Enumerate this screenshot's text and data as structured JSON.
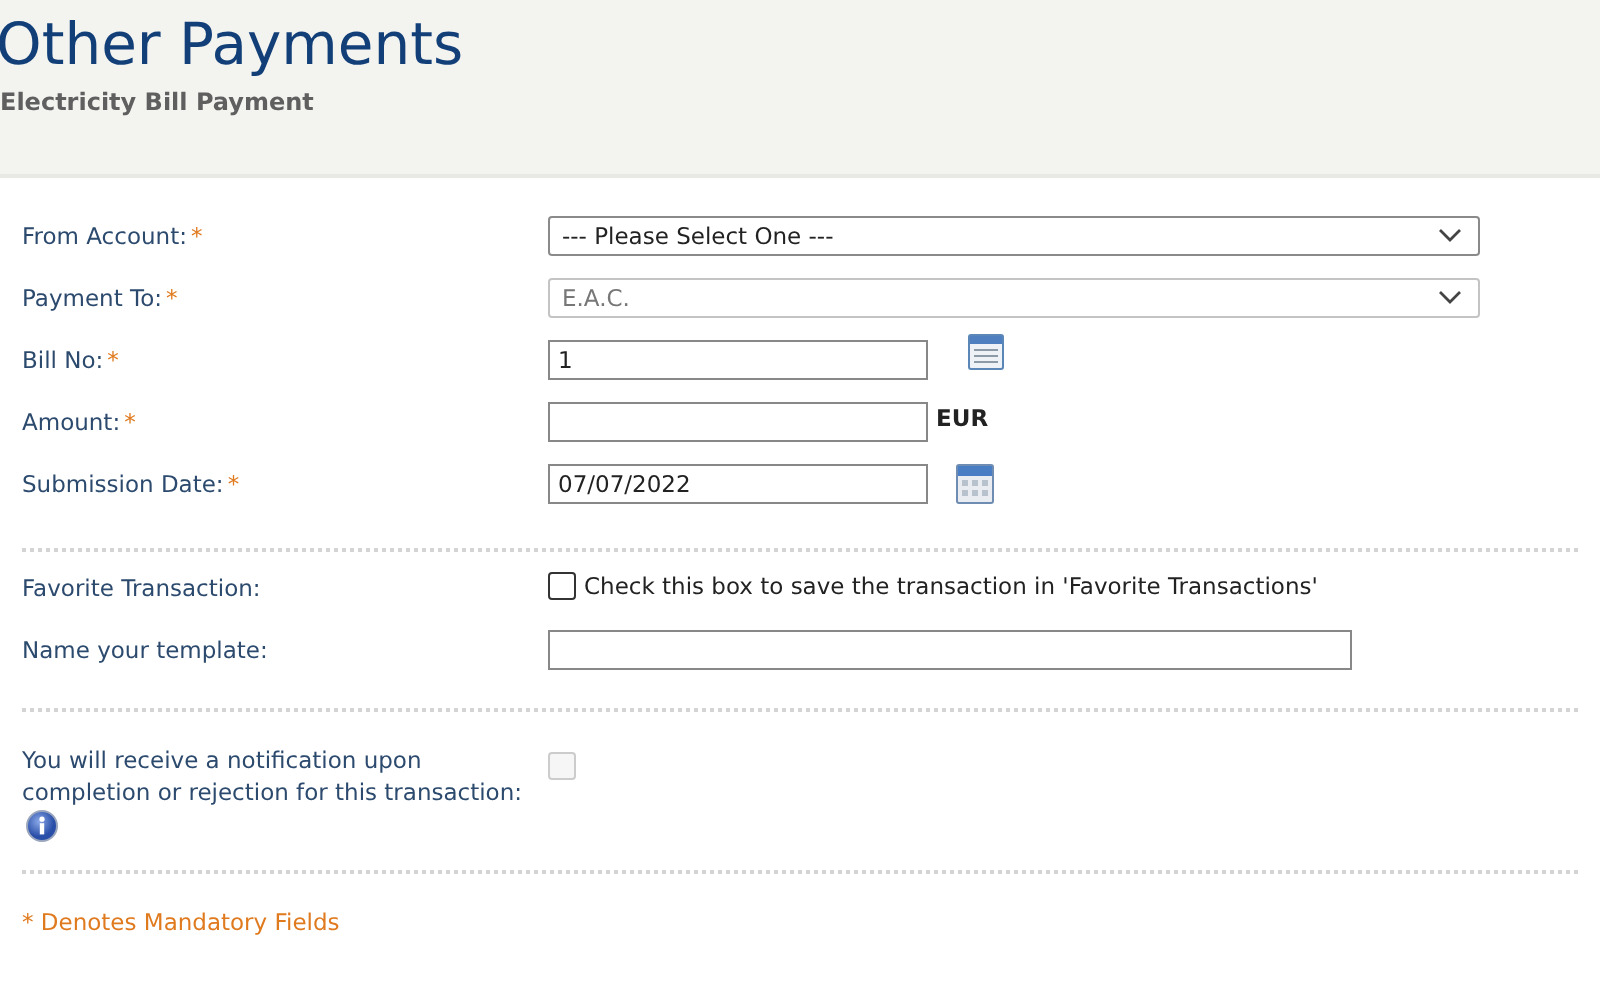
{
  "header": {
    "title": "Other Payments",
    "subtitle": "Electricity Bill Payment"
  },
  "sections": [
    {
      "fields": [
        {
          "kind": "select",
          "label": "From Account:",
          "asterisk": "*",
          "value": "--- Please Select One ---",
          "disabled": false
        },
        {
          "kind": "select",
          "label": "Payment To:",
          "asterisk": "*",
          "value": "E.A.C.",
          "disabled": true
        },
        {
          "kind": "lookup",
          "label": "Bill No:",
          "asterisk": "*",
          "value": "1"
        },
        {
          "kind": "text",
          "label": "Amount:",
          "asterisk": "*",
          "suffix": "EUR"
        },
        {
          "kind": "date",
          "label": "Submission Date:",
          "asterisk": "*",
          "value": "07/07/2022"
        }
      ]
    },
    {
      "fields": [
        {
          "kind": "checkbox",
          "label": "Favorite Transaction:",
          "checked": false,
          "disabled": false,
          "text": "Check this box to save the transaction in 'Favorite Transactions'"
        },
        {
          "kind": "wide-text",
          "label": "Name your template:"
        }
      ]
    },
    {
      "fields": [
        {
          "kind": "checkbox",
          "label": "You will receive a notification upon completion or rejection for this transaction:",
          "info": true,
          "checked": false,
          "disabled": true
        }
      ]
    }
  ],
  "note": "* Denotes Mandatory Fields"
}
